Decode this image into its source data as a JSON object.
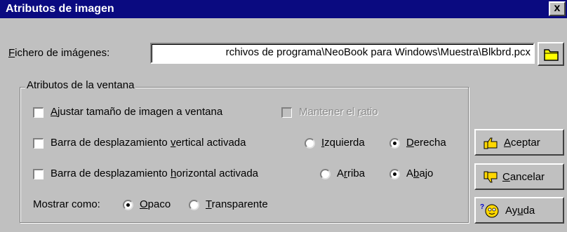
{
  "window": {
    "title": "Atributos de imagen",
    "close_label": "x"
  },
  "file": {
    "label_first": "F",
    "label_rest": "ichero de imágenes:",
    "value": "rchivos de programa\\NeoBook para Windows\\Muestra\\Blkbrd.pcx"
  },
  "group": {
    "title": "Atributos de la ventana",
    "fit_check": {
      "before": "",
      "u": "A",
      "after": "justar tamaño de imagen a ventana",
      "checked": false
    },
    "ratio_check": {
      "before": "Mantener el ",
      "u": "r",
      "after": "atio",
      "checked": false,
      "disabled": true
    },
    "vscroll_check": {
      "before": "Barra de desplazamiento ",
      "u": "v",
      "after": "ertical activada",
      "checked": false
    },
    "vscroll_left": {
      "before": "",
      "u": "I",
      "after": "zquierda",
      "selected": false
    },
    "vscroll_right": {
      "before": "",
      "u": "D",
      "after": "erecha",
      "selected": true
    },
    "hscroll_check": {
      "before": "Barra de desplazamiento ",
      "u": "h",
      "after": "orizontal activada",
      "checked": false
    },
    "hscroll_top": {
      "before": "A",
      "u": "r",
      "after": "riba",
      "selected": false
    },
    "hscroll_bottom": {
      "before": "A",
      "u": "b",
      "after": "ajo",
      "selected": true
    },
    "show_as_label": "Mostrar como:",
    "opaque": {
      "before": "",
      "u": "O",
      "after": "paco",
      "selected": true
    },
    "transparent": {
      "before": "",
      "u": "T",
      "after": "ransparente",
      "selected": false
    }
  },
  "buttons": {
    "accept": {
      "before": "",
      "u": "A",
      "after": "ceptar",
      "icon": "thumbs-up-icon"
    },
    "cancel": {
      "before": "",
      "u": "C",
      "after": "ancelar",
      "icon": "thumbs-down-icon"
    },
    "help": {
      "before": "Ay",
      "u": "u",
      "after": "da",
      "icon": "help-face-icon"
    }
  },
  "colors": {
    "titlebar": "#0a0a80",
    "face": "#c0c0c0",
    "disabled_text": "#8a8a8a"
  }
}
